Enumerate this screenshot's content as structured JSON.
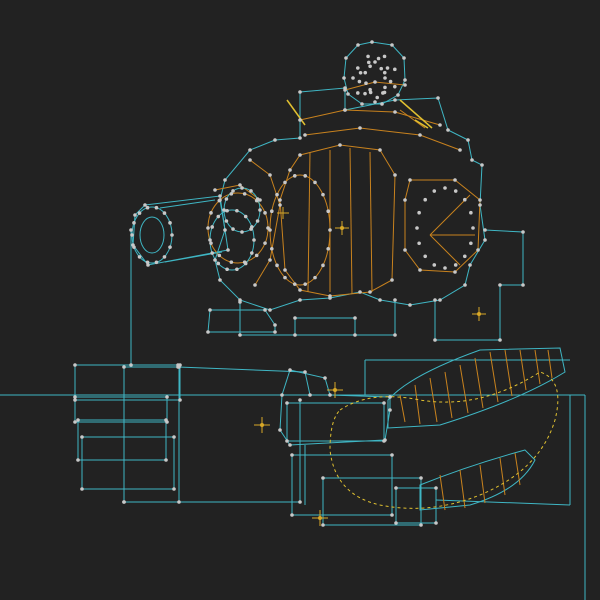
{
  "app": {
    "view": "uv-wireframe-editor",
    "background_color": "#222222"
  },
  "palette": {
    "cyan": "#3fb6c4",
    "orange": "#c8821e",
    "dot": "#c8c8c8",
    "yellow": "#e0c030",
    "cross": "#d8a828"
  },
  "icons": {
    "pivot_marker": "crosshair-icon",
    "vertex": "vertex-dot-icon"
  }
}
